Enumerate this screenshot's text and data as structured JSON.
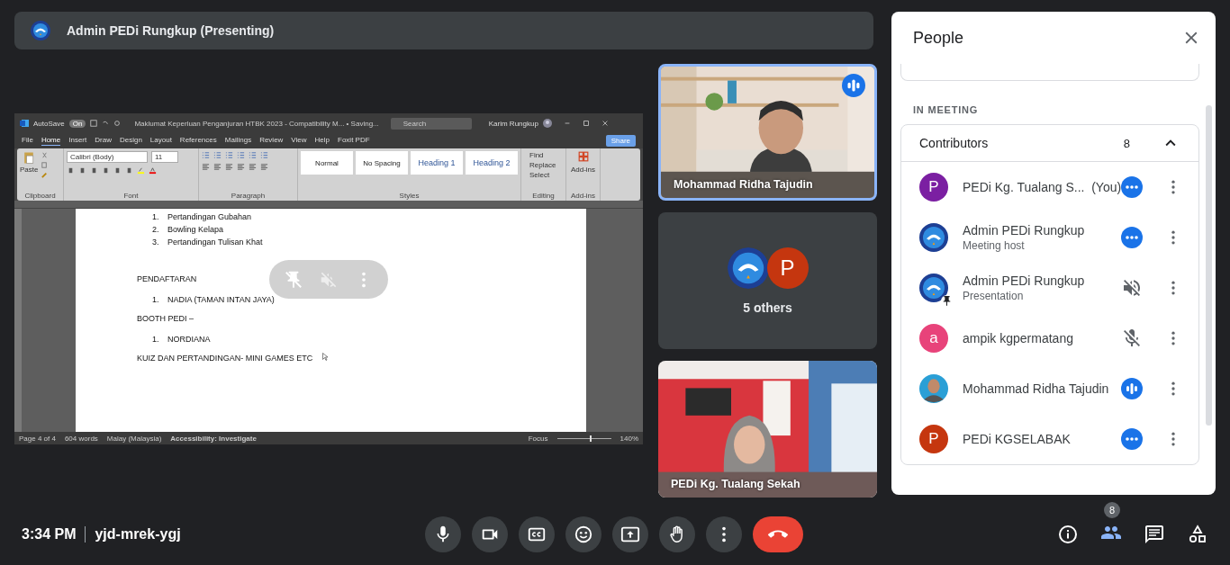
{
  "presenter_bar": {
    "title": "Admin PEDi Rungkup (Presenting)"
  },
  "shared_screen": {
    "word": {
      "autosave_label": "AutoSave",
      "autosave_state": "On",
      "doc_title": "Maklumat Keperluan Penganjuran HTBK 2023 - Compatibility M... • Saving...",
      "search_placeholder": "Search",
      "user": "Karim Rungkup",
      "tabs": [
        {
          "label": "File",
          "selected": false
        },
        {
          "label": "Home",
          "selected": true
        },
        {
          "label": "Insert",
          "selected": false
        },
        {
          "label": "Draw",
          "selected": false
        },
        {
          "label": "Design",
          "selected": false
        },
        {
          "label": "Layout",
          "selected": false
        },
        {
          "label": "References",
          "selected": false
        },
        {
          "label": "Mailings",
          "selected": false
        },
        {
          "label": "Review",
          "selected": false
        },
        {
          "label": "View",
          "selected": false
        },
        {
          "label": "Help",
          "selected": false
        },
        {
          "label": "Foxit PDF",
          "selected": false
        }
      ],
      "share": "Share",
      "paste": "Paste",
      "font_name": "Calibri (Body)",
      "font_size": "11",
      "styles": [
        {
          "label": "Normal",
          "kind": "plain"
        },
        {
          "label": "No Spacing",
          "kind": "plain"
        },
        {
          "label": "Heading 1",
          "kind": "heading"
        },
        {
          "label": "Heading 2",
          "kind": "heading"
        }
      ],
      "editing": [
        "Find",
        "Replace",
        "Select"
      ],
      "addins": "Add-ins",
      "groups": [
        "Clipboard",
        "Font",
        "Paragraph",
        "Styles",
        "Editing",
        "Add-ins"
      ],
      "document": [
        {
          "kind": "list",
          "items": [
            {
              "number": "1.",
              "text": "Pertandingan Gubahan"
            },
            {
              "number": "2.",
              "text": "Bowling Kelapa"
            },
            {
              "number": "3.",
              "text": "Pertandingan Tulisan Khat"
            }
          ]
        },
        {
          "kind": "heading",
          "text": "PENDAFTARAN"
        },
        {
          "kind": "list",
          "items": [
            {
              "number": "1.",
              "text": "NADIA (TAMAN INTAN JAYA)"
            }
          ]
        },
        {
          "kind": "para",
          "text": "BOOTH PEDI –"
        },
        {
          "kind": "list",
          "items": [
            {
              "number": "1.",
              "text": "NORDIANA"
            }
          ]
        },
        {
          "kind": "para",
          "text": "KUIZ DAN PERTANDINGAN- MINI GAMES ETC"
        }
      ],
      "status": {
        "page": "Page 4 of 4",
        "words": "604 words",
        "language": "Malay (Malaysia)",
        "accessibility": "Accessibility: Investigate",
        "focus": "Focus",
        "zoom_slider": {
          "level": 0.6
        },
        "zoom": "140%"
      }
    }
  },
  "tiles": [
    {
      "kind": "video",
      "name": "Mohammad Ridha Tajudin",
      "speaking": true
    },
    {
      "kind": "others",
      "label": "5 others",
      "avatar_letter": "P"
    },
    {
      "kind": "video",
      "name": "PEDi Kg. Tualang Sekah",
      "speaking": false
    }
  ],
  "people_panel": {
    "title": "People",
    "section": "IN MEETING",
    "group": {
      "label": "Contributors",
      "count": "8",
      "expanded": true
    },
    "participants": [
      {
        "name": "PEDi Kg. Tualang S...",
        "suffix": "(You)",
        "avatar": {
          "kind": "letter",
          "letter": "P",
          "color": "#7b1fa2",
          "pinned": false
        },
        "indicator": {
          "kind": "dots"
        }
      },
      {
        "name": "Admin PEDi Rungkup",
        "subtitle": "Meeting host",
        "avatar": {
          "kind": "logo",
          "pinned": false
        },
        "indicator": {
          "kind": "dots"
        }
      },
      {
        "name": "Admin PEDi Rungkup",
        "subtitle": "Presentation",
        "avatar": {
          "kind": "logo",
          "pinned": true
        },
        "indicator": {
          "kind": "soundoff"
        }
      },
      {
        "name": "ampik kgpermatang",
        "avatar": {
          "kind": "letter",
          "letter": "a",
          "color": "#e8437a",
          "pinned": false
        },
        "indicator": {
          "kind": "micoff"
        }
      },
      {
        "name": "Mohammad Ridha Tajudin",
        "indicator": {
          "kind": "bars"
        }
      },
      {
        "name": "PEDi KGSELABAK",
        "avatar": {
          "kind": "letter",
          "letter": "P",
          "color": "#c5360f",
          "pinned": false
        },
        "indicator": {
          "kind": "dots"
        }
      }
    ]
  },
  "bottom_bar": {
    "time": "3:34 PM",
    "meeting_code": "yjd-mrek-ygj",
    "people_badge": "8"
  }
}
